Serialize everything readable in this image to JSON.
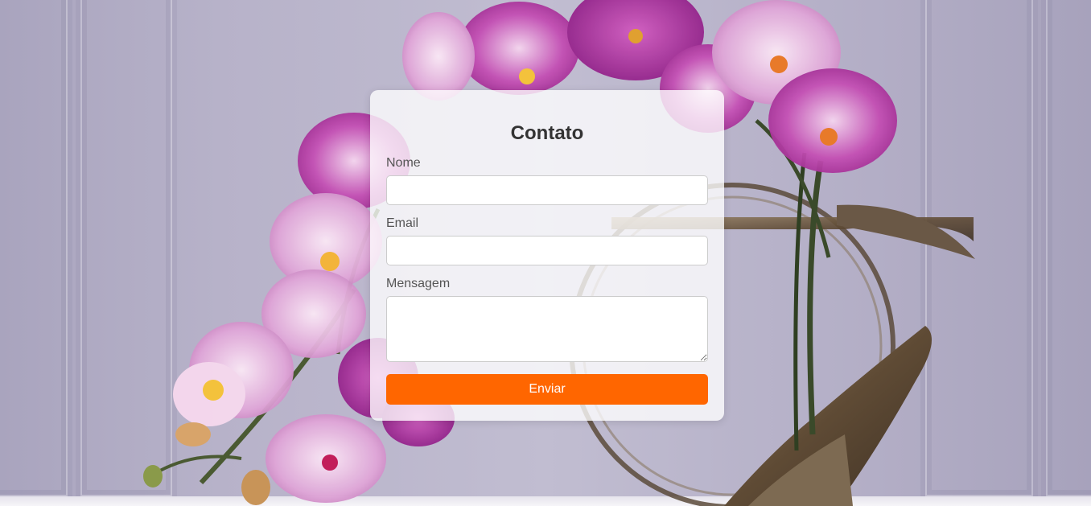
{
  "form": {
    "title": "Contato",
    "name_label": "Nome",
    "name_value": "",
    "email_label": "Email",
    "email_value": "",
    "message_label": "Mensagem",
    "message_value": "",
    "submit_label": "Enviar"
  },
  "colors": {
    "accent": "#ff6600",
    "title_text": "#333333",
    "label_text": "#555555",
    "card_background": "rgba(255,255,255,0.78)",
    "orchid": "#b0309c"
  }
}
